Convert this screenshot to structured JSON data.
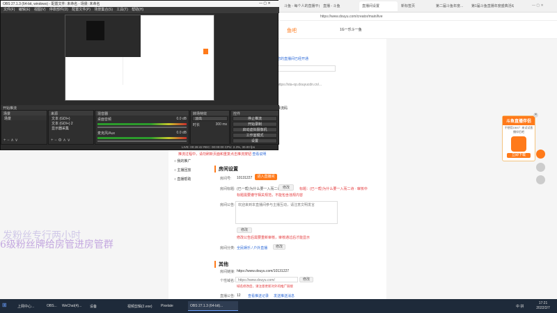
{
  "obs": {
    "title": "OBS 27.1.3 (64-bit, windows) - 配置文件: 未命名 - 场景: 未命名",
    "menu": [
      "文件(F)",
      "编辑(E)",
      "视图(V)",
      "停靠部件(D)",
      "配置文件(P)",
      "场景集合(S)",
      "工具(T)",
      "帮助(H)"
    ],
    "docks": {
      "scenes": "场景",
      "sources": "来源",
      "mixer": "混音器",
      "transitions": "转场特效",
      "controls": "控件"
    },
    "scenes": [
      "场景"
    ],
    "sources": [
      "文本 (GDI+)",
      "文本 (GDI+) 2",
      "显示器采集"
    ],
    "mixer": [
      {
        "name": "桌面音频",
        "db": "0.0 dB"
      },
      {
        "name": "麦克风/Aux",
        "db": "0.0 dB"
      }
    ],
    "transition": {
      "type": "淡出",
      "duration_label": "时长",
      "duration": "300 ms"
    },
    "controls": [
      "停止推流",
      "开始录制",
      "启动虚拟摄像机",
      "工作室模式",
      "设置",
      "退出"
    ],
    "status": "LIVE: 00:28:42   REC: 00:00:00   CPU: 2.3%, 30.00 fps",
    "top_label": "开始推流"
  },
  "browser": {
    "tabs": [
      "斗鱼 - 每个人的直播平台",
      "直播 - 斗鱼",
      "直播间设置",
      "新标签页",
      "第二届斗鱼年度...",
      "第1届斗鱼直播年度盛典活动"
    ],
    "address": "https://www.douyu.com/creator/main/live",
    "site_header": {
      "nav": "鱼吧",
      "user": "1G一乐斗一鱼"
    }
  },
  "page": {
    "left_text_lines": [
      "开播测试",
      "您的直播间已经开通",
      "RTMP推流设置",
      "https://sta-op.douyucdn.cn/...",
      "直播码获取",
      "推流码",
      "复制以上推流码到OBS中使用",
      "你好"
    ],
    "warning": "推流过程中，请勿刷新页面和重复点击推流按钮",
    "warning_link": "查看说明",
    "sidebar": [
      "我的推广",
      "主播回放",
      "直播帮助"
    ],
    "room_settings": {
      "title": "房间设置",
      "room_no_label": "房间号:",
      "room_no": "10131227",
      "apply_btn": "进入直播间",
      "title_label": "房间标题:",
      "title_value": "(已一帮)为什么要一入而二诗",
      "title_btn": "修改",
      "title_note": "标题：(已一帮)为什么要一入而二诗 · 审核中",
      "title_hint": "标题需要遵守相关规范，不能包含违规内容",
      "notice_label": "房间公告:",
      "notice_value": "欢迎来到本直播间参与主播互动，请注意文明发言",
      "notice_btn": "修改",
      "notice_hint": "修改公告后需要重新审核，审核通过后才能显示",
      "category_label": "房间分类:",
      "category_value": "全民娱乐 / 户外直播",
      "category_btn": "修改"
    },
    "other": {
      "title": "其他",
      "link_label": "房间链接:",
      "link_value": "https://www.douyu.com/10131227",
      "custom_label": "个性域名:",
      "custom_value": "https://www.douyu.com/",
      "custom_btn": "修改",
      "custom_hint": "域名修改后，请注意更新对外的推广链接",
      "msg_label": "直播公告:",
      "msg_count": "12",
      "msg_link1": "查看推送记录",
      "msg_link2": "发送推送消息"
    }
  },
  "overlay": {
    "line1": "发粉丝专行两小时",
    "line2": "6级粉丝牌给房管进房管群"
  },
  "promo": {
    "title": "斗鱼直播伴侣",
    "subtitle": "不想用OBS？来试试直播伴侣吧",
    "cta": "立即下载"
  },
  "taskbar": {
    "items": [
      "上网中心...",
      "OBS...",
      "WeChat(4)...",
      "设备",
      "视频剪辑(2.exe)",
      "Pixelate",
      "OBS 27.1.3 (64-bit)..."
    ],
    "time": "17:21",
    "date": "2022/2/7",
    "tray": "中 拼"
  },
  "colors": {
    "accent": "#ff7a1a",
    "danger": "#e4393c",
    "link": "#2f6bd8",
    "obs_bg": "#2a2a2a"
  }
}
